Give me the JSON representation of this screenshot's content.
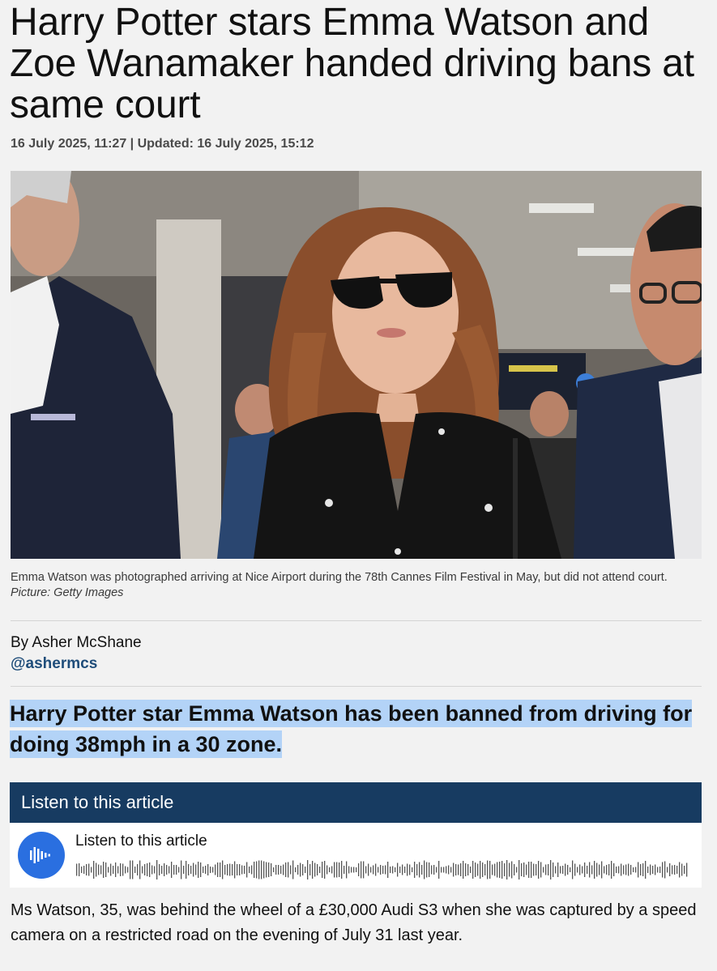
{
  "article": {
    "headline": "Harry Potter stars Emma Watson and Zoe Wanamaker handed driving bans at same court",
    "dateline": "16 July 2025, 11:27 | Updated: 16 July 2025, 15:12",
    "caption_text": "Emma Watson was photographed arriving at Nice Airport during the 78th Cannes Film Festival in May, but did not attend court.",
    "caption_credit": "Picture: Getty Images",
    "byline": "By Asher McShane",
    "author_handle": "@ashermcs",
    "lede": "Harry Potter star Emma Watson has been banned from driving for doing 38mph in a 30 zone.",
    "body": "Ms Watson, 35, was behind the wheel of a £30,000 Audi S3 when she was captured by a speed camera on a restricted road on the evening of July 31 last year."
  },
  "audio": {
    "header_label": "Listen to this article",
    "player_title": "Listen to this article",
    "play_icon": "audio-wave-icon"
  },
  "colors": {
    "page_bg": "#f2f2f2",
    "listen_header_bg": "#173b61",
    "play_button": "#2a6fe0",
    "highlight": "#b3d3f7",
    "handle": "#1f4d7a"
  }
}
